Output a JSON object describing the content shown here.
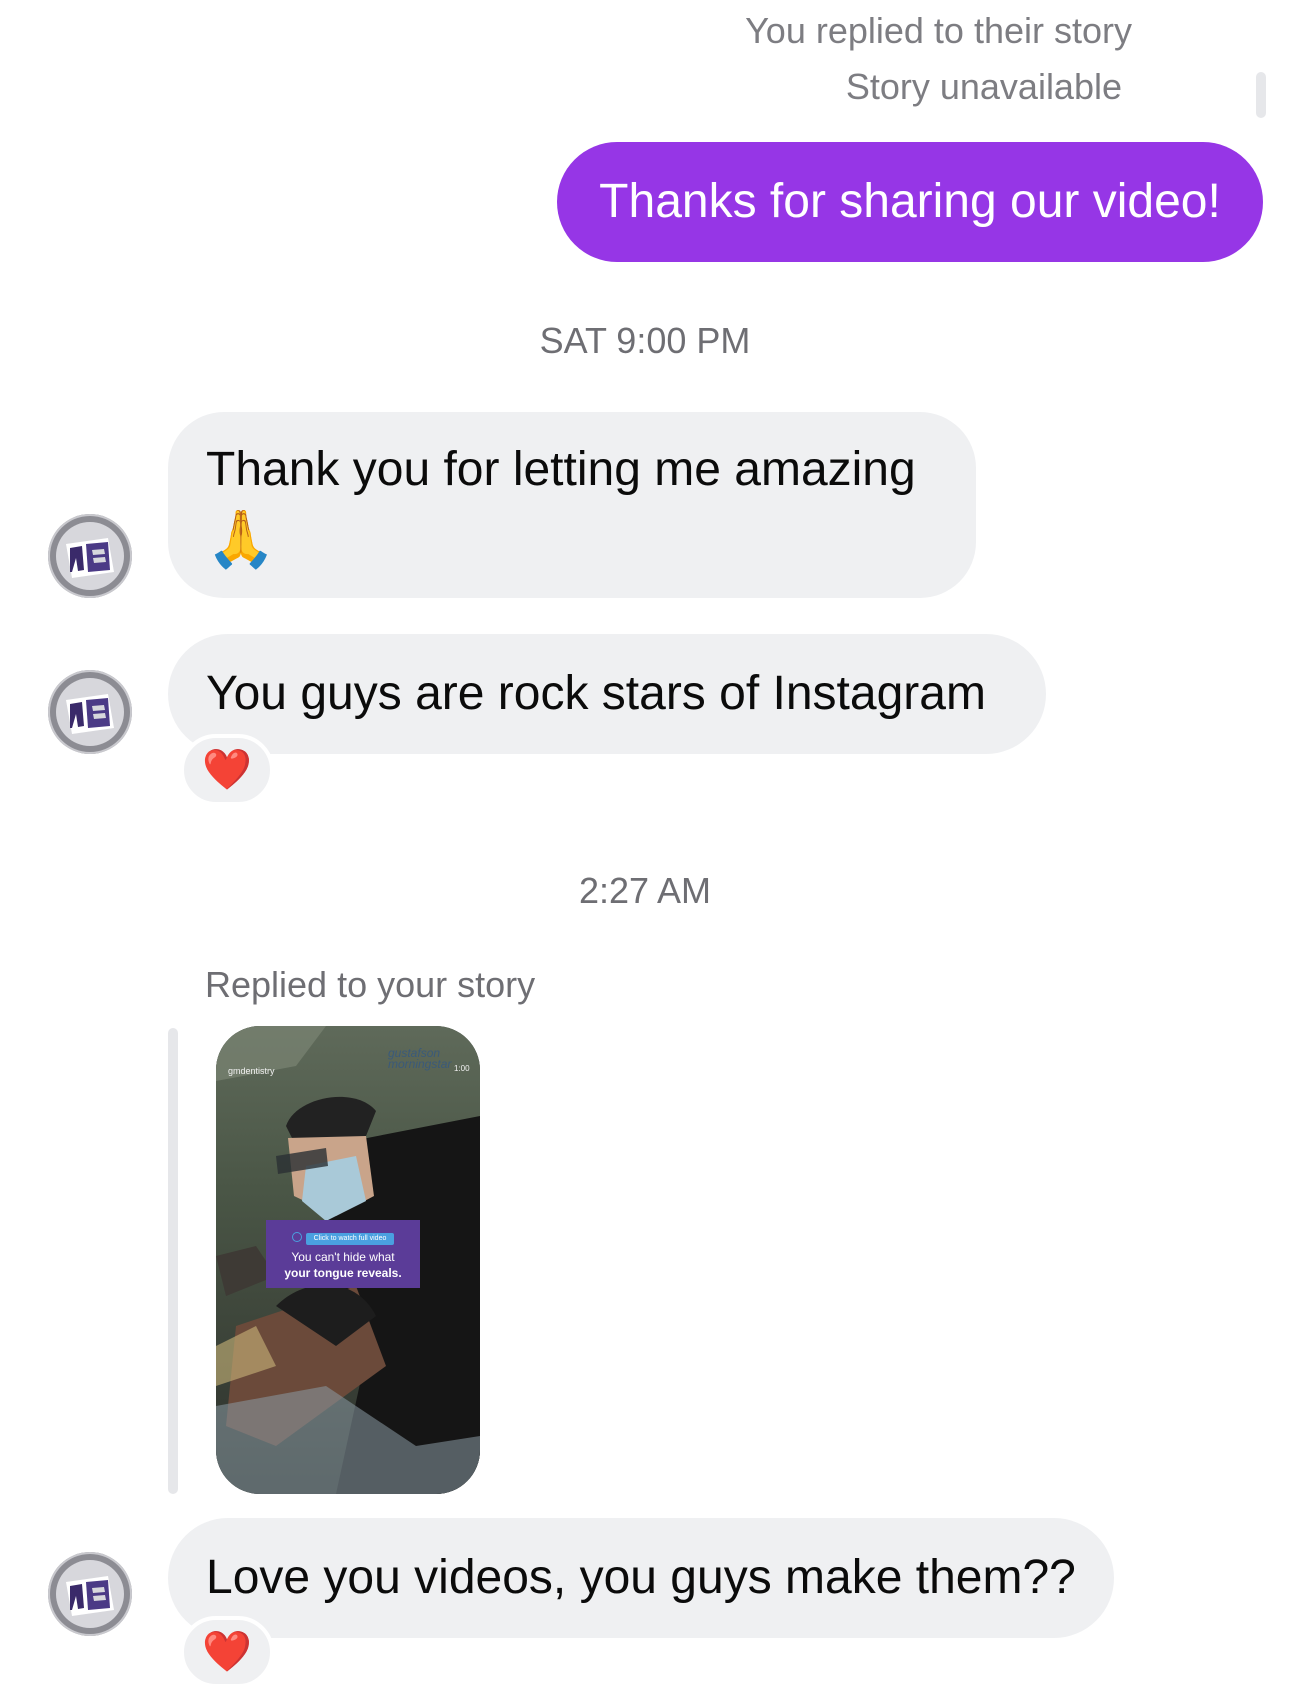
{
  "outgoing": {
    "reply_meta": "You replied to their story",
    "story_status": "Story unavailable",
    "message": "Thanks for sharing our video!"
  },
  "timestamps": {
    "first": "SAT 9:00 PM",
    "second": "2:27 AM"
  },
  "incoming": {
    "msg1_line1": "Thank you for letting me amazing",
    "msg1_emoji": "🙏",
    "msg2": "You guys are rock stars  of Instagram",
    "msg2_reaction": "❤️",
    "story_reply_label": "Replied to your story",
    "msg3": "Love you videos, you guys make them??",
    "msg3_reaction": "❤️"
  },
  "story_preview": {
    "handle": "gmdentistry",
    "logo_line1": "gustafson",
    "logo_line2": "morningstar",
    "time_label": "1:00",
    "button_label": "Click to watch full video",
    "caption_line1": "You can't hide what",
    "caption_line2": "your tongue reveals."
  },
  "colors": {
    "sent_bubble": "#9636e6",
    "received_bubble": "#eff0f2",
    "meta_text": "#6e6e73"
  }
}
